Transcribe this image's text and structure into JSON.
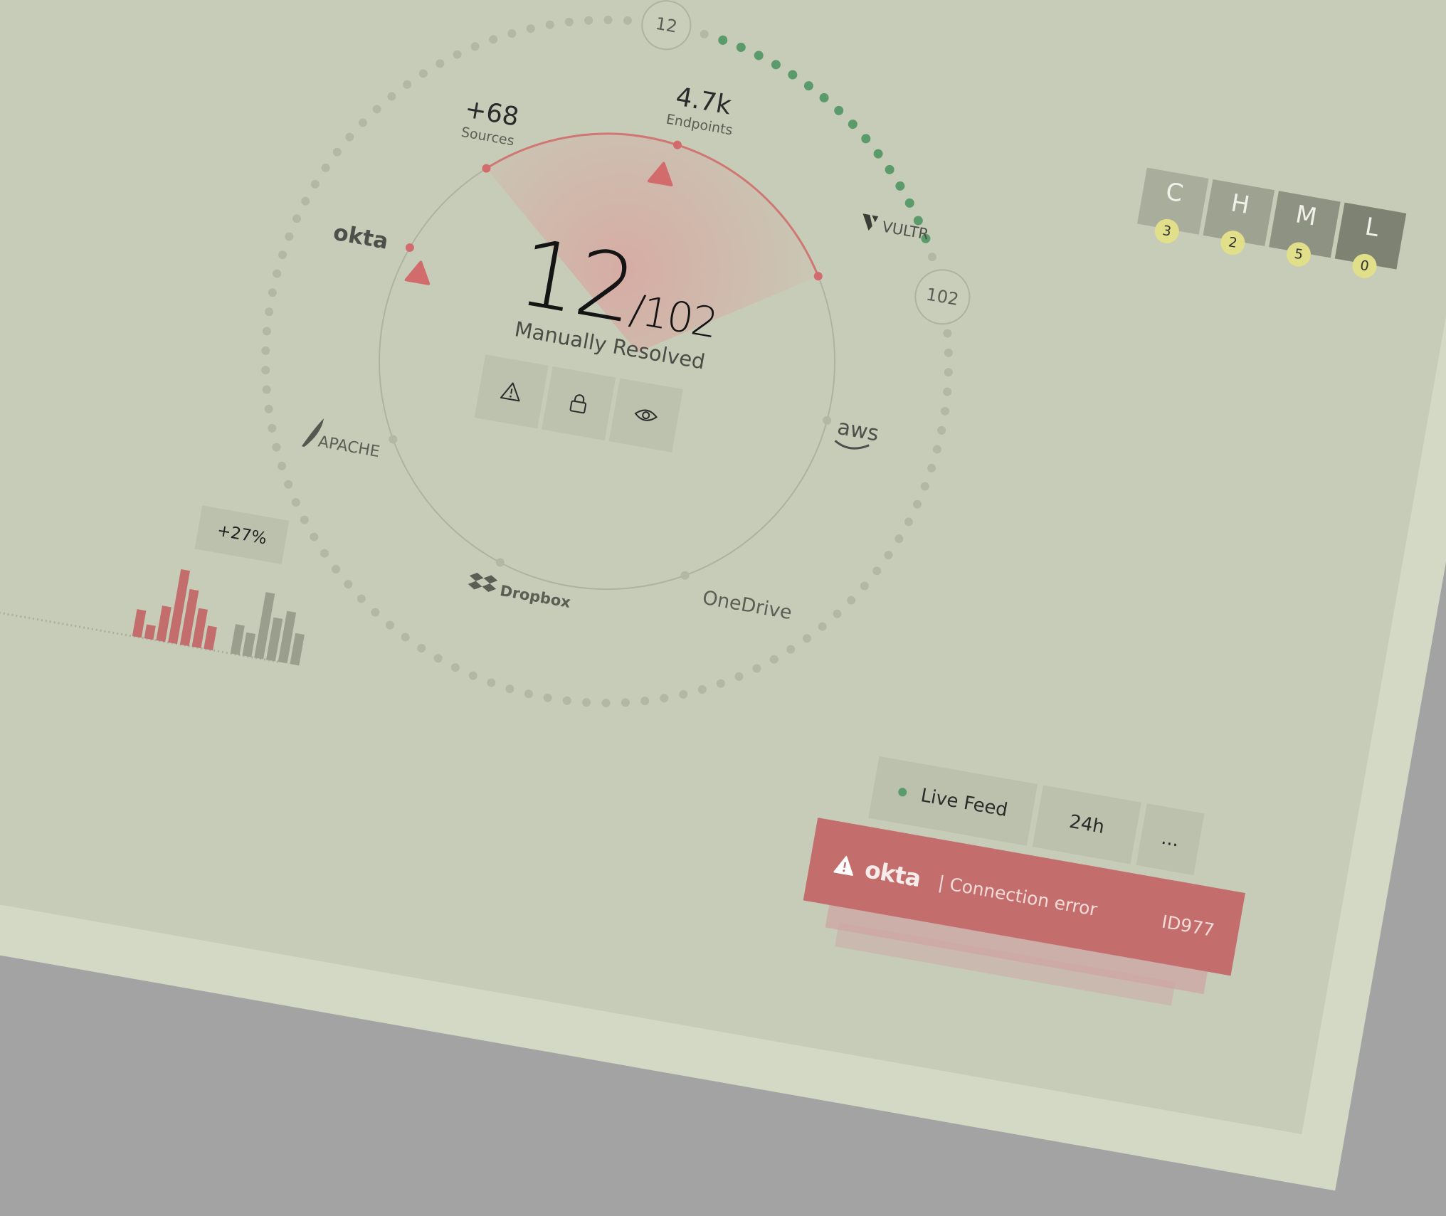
{
  "dial": {
    "resolved": "12",
    "total": "/102",
    "caption": "Manually Resolved",
    "marker_top": "12",
    "marker_right": "102",
    "progress_fraction": 0.118
  },
  "stats": {
    "sources_value": "+68",
    "sources_label": "Sources",
    "endpoints_value": "4.7k",
    "endpoints_label": "Endpoints"
  },
  "integrations": {
    "okta": "okta",
    "vultr": "VULTR",
    "aws": "aws",
    "onedrive": "OneDrive",
    "dropbox": "Dropbox",
    "apache": "APACHE"
  },
  "actions": [
    {
      "icon": "warning-icon"
    },
    {
      "icon": "lock-icon"
    },
    {
      "icon": "eye-icon"
    }
  ],
  "severity": [
    {
      "letter": "C",
      "count": "3",
      "color": "#a9ad9b"
    },
    {
      "letter": "H",
      "count": "2",
      "color": "#9ea290"
    },
    {
      "letter": "M",
      "count": "5",
      "color": "#8e9282"
    },
    {
      "letter": "L",
      "count": "0",
      "color": "#7e8273"
    }
  ],
  "feed": {
    "live_label": "Live Feed",
    "range_label": "24h",
    "more_label": "..."
  },
  "alert": {
    "brand": "okta",
    "message": "| Connection error",
    "id": "ID977"
  },
  "sparkline": {
    "change_label": "+27%",
    "red_bars": [
      0.35,
      0.18,
      0.45,
      0.95,
      0.72,
      0.5,
      0.3
    ],
    "grey_bars": [
      0.38,
      0.3,
      0.85,
      0.55,
      0.66,
      0.4
    ]
  },
  "colors": {
    "accent_red": "#c46d6d",
    "accent_green": "#5a9a6b",
    "background": "#c6ccb8",
    "frame": "#d4d9c5"
  }
}
